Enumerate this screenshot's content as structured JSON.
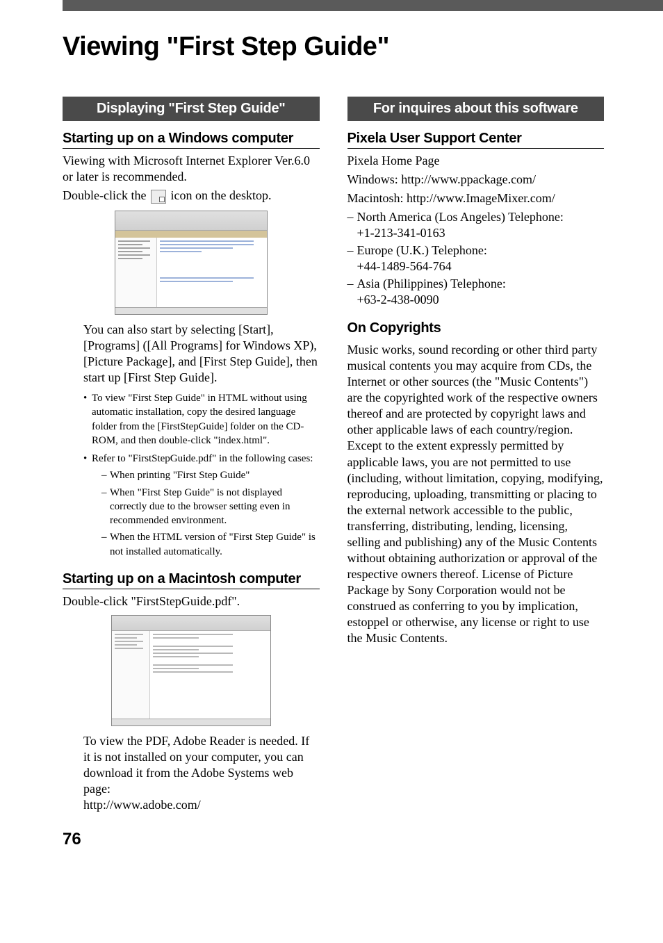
{
  "page": {
    "title": "Viewing \"First Step Guide\"",
    "number": "76"
  },
  "left": {
    "sectionBar": "Displaying \"First Step Guide\"",
    "h2a": "Starting up on a Windows computer",
    "p1": "Viewing with Microsoft Internet Explorer Ver.6.0 or later is recommended.",
    "p2a": "Double-click the ",
    "p2b": " icon on the desktop.",
    "indent1": "You can also start by selecting [Start], [Programs] ([All Programs] for Windows XP), [Picture Package], and [First Step Guide], then start up [First Step Guide].",
    "bullet1": "To view \"First Step Guide\" in HTML without using automatic installation, copy the desired language folder from the [FirstStepGuide] folder on the CD-ROM, and then double-click \"index.html\".",
    "bullet2": "Refer to \"FirstStepGuide.pdf\" in the following cases:",
    "dash1": "When printing \"First Step Guide\"",
    "dash2": "When \"First Step Guide\" is not displayed correctly due to the browser setting even in recommended environment.",
    "dash3": "When the HTML version of \"First Step Guide\" is not installed automatically.",
    "h2b": "Starting up on a Macintosh computer",
    "p3": "Double-click \"FirstStepGuide.pdf\".",
    "indent2": "To view the PDF, Adobe Reader is needed. If it is not installed on your computer, you can download it from the Adobe Systems web page:",
    "indent2url": "http://www.adobe.com/"
  },
  "right": {
    "sectionBar": "For inquires about this software",
    "h2a": "Pixela User Support Center",
    "p1": "Pixela Home Page",
    "p2": "Windows: http://www.ppackage.com/",
    "p3": "Macintosh: http://www.ImageMixer.com/",
    "tel1a": "North America (Los Angeles) Telephone:",
    "tel1b": "+1-213-341-0163",
    "tel2a": "Europe (U.K.) Telephone:",
    "tel2b": "+44-1489-564-764",
    "tel3a": "Asia (Philippines) Telephone:",
    "tel3b": "+63-2-438-0090",
    "h2b": "On Copyrights",
    "copy": "Music works, sound recording or other third party musical contents you may acquire from CDs, the Internet or other sources (the \"Music Contents\") are the copyrighted work of the respective owners thereof and are protected by copyright laws and other applicable laws of each country/region. Except to the extent expressly permitted by applicable laws, you are not permitted to use (including, without limitation, copying, modifying, reproducing, uploading, transmitting or placing to the external network accessible to the public, transferring, distributing, lending, licensing, selling and publishing) any of the Music Contents without obtaining authorization or approval of the respective owners thereof. License of Picture Package by Sony Corporation would not be construed as conferring to you by implication, estoppel or otherwise, any license or right to use the Music Contents."
  }
}
